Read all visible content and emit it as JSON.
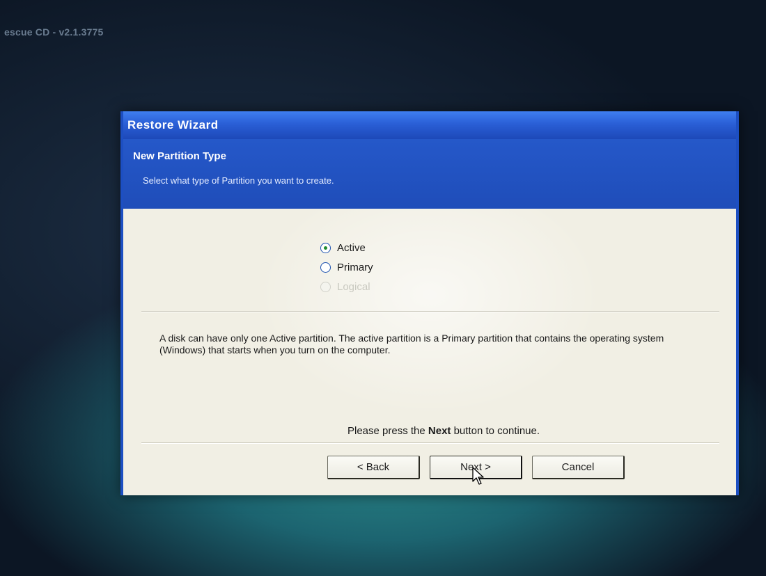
{
  "screen": {
    "title": "escue CD - v2.1.3775"
  },
  "wizard": {
    "window_title": "Restore Wizard",
    "header_title": "New Partition Type",
    "header_subtitle": "Select what type of Partition you want to create.",
    "options": [
      {
        "label": "Active",
        "checked": true,
        "enabled": true
      },
      {
        "label": "Primary",
        "checked": false,
        "enabled": true
      },
      {
        "label": "Logical",
        "checked": false,
        "enabled": false
      }
    ],
    "description": "A disk can have only one Active partition. The active partition is a Primary partition that contains the operating system (Windows) that starts when you turn on the computer.",
    "hint_prefix": "Please press the ",
    "hint_bold": "Next",
    "hint_suffix": " button to continue.",
    "buttons": {
      "back": "< Back",
      "next": "Next >",
      "cancel": "Cancel"
    }
  },
  "icons": {
    "cursor": "arrow-cursor-icon"
  },
  "colors": {
    "titlebar_blue": "#2a5fd6",
    "header_blue": "#1f4db9",
    "body_bg": "#f1efe4",
    "radio_dot": "#1e8a2e"
  }
}
